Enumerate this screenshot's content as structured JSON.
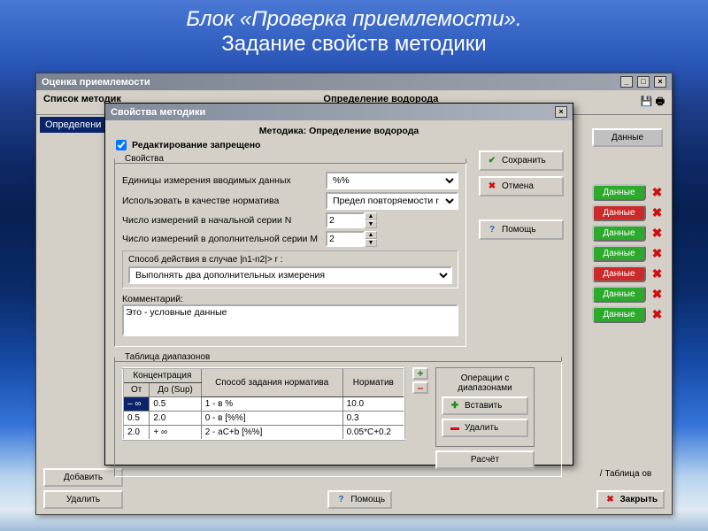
{
  "slide": {
    "line1": "Блок «Проверка приемлемости».",
    "line2": "Задание свойств методики"
  },
  "backWindow": {
    "title": "Оценка приемлемости",
    "header_left": "Список методик",
    "header_right": "Определение водорода",
    "selected_row": "Определени",
    "top_right_btn": "Данные",
    "pills": [
      {
        "label": "Данные",
        "cls": "pill-green"
      },
      {
        "label": "Данные",
        "cls": "pill-red"
      },
      {
        "label": "Данные",
        "cls": "pill-green"
      },
      {
        "label": "Данные",
        "cls": "pill-green"
      },
      {
        "label": "Данные",
        "cls": "pill-red"
      },
      {
        "label": "Данные",
        "cls": "pill-green"
      },
      {
        "label": "Данные",
        "cls": "pill-green"
      }
    ],
    "btn_add": "Добавить",
    "btn_del": "Удалить",
    "btn_help": "Помощь",
    "btn_close": "Закрыть",
    "bottom_label": "/ Таблица ов"
  },
  "dialog": {
    "title": "Свойства методики",
    "subtitle": "Методика:  Определение водорода",
    "chk_label": "Редактирование запрещено",
    "chk_checked": true,
    "props_legend": "Свойства",
    "rows": {
      "units_label": "Единицы измерения вводимых данных",
      "units_value": "%%",
      "norm_label": "Использовать в качестве норматива",
      "norm_value": "Предел повторяемости r",
      "n_label": "Число измерений в начальной серии N",
      "n_value": "2",
      "m_label": "Число измерений в дополнительной серии M",
      "m_value": "2",
      "action_label": "Способ действия в случае |n1-n2|> r :",
      "action_value": "Выполнять два дополнительных измерения",
      "comment_label": "Комментарий:",
      "comment_value": "Это - условные данные"
    },
    "buttons": {
      "save": "Сохранить",
      "cancel": "Отмена",
      "help": "Помощь"
    },
    "ranges": {
      "legend": "Таблица диапазонов",
      "hdr_conc": "Концентрация",
      "hdr_from": "От",
      "hdr_to": "До (Sup)",
      "hdr_mode": "Способ задания норматива",
      "hdr_norm": "Норматив",
      "rows": [
        {
          "from": "– ∞",
          "to": "0.5",
          "mode": "1 - в %",
          "norm": "10.0",
          "sel": true
        },
        {
          "from": "0.5",
          "to": "2.0",
          "mode": "0 - в [%%]",
          "norm": "0.3",
          "sel": false
        },
        {
          "from": "2.0",
          "to": "+ ∞",
          "mode": "2 - aC+b [%%]",
          "norm": "0.05*C+0.2",
          "sel": false
        }
      ],
      "ops_header": "Операции с диапазонами",
      "btn_insert": "Вставить",
      "btn_delete": "Удалить",
      "btn_calc": "Расчёт"
    }
  }
}
